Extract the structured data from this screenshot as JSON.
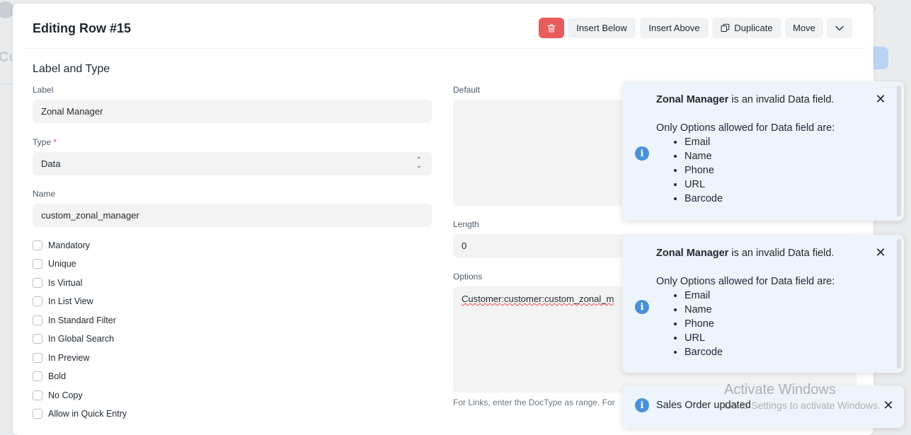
{
  "background": {
    "page_title": "Cu"
  },
  "dialog": {
    "title": "Editing Row #15",
    "toolbar": {
      "delete_icon": "trash-icon",
      "insert_below": "Insert Below",
      "insert_above": "Insert Above",
      "duplicate": "Duplicate",
      "move": "Move",
      "more_icon": "chevron-down-icon"
    },
    "section_title": "Label and Type",
    "fields": {
      "label": {
        "label": "Label",
        "value": "Zonal Manager"
      },
      "type": {
        "label": "Type",
        "required_mark": "*",
        "value": "Data"
      },
      "name": {
        "label": "Name",
        "value": "custom_zonal_manager"
      },
      "default": {
        "label": "Default",
        "value": ""
      },
      "length": {
        "label": "Length",
        "value": "0"
      },
      "options": {
        "label": "Options",
        "value": "Customer:customer:custom_zonal_m",
        "help": "For Links, enter the DocType as range. For"
      }
    },
    "checkboxes": [
      {
        "label": "Mandatory",
        "checked": false
      },
      {
        "label": "Unique",
        "checked": false
      },
      {
        "label": "Is Virtual",
        "checked": false
      },
      {
        "label": "In List View",
        "checked": false
      },
      {
        "label": "In Standard Filter",
        "checked": false
      },
      {
        "label": "In Global Search",
        "checked": false
      },
      {
        "label": "In Preview",
        "checked": false
      },
      {
        "label": "Bold",
        "checked": false
      },
      {
        "label": "No Copy",
        "checked": false
      },
      {
        "label": "Allow in Quick Entry",
        "checked": false
      }
    ]
  },
  "toasts": [
    {
      "bold": "Zonal Manager",
      "message": " is an invalid Data field.",
      "intro": "Only Options allowed for Data field are:",
      "options": [
        "Email",
        "Name",
        "Phone",
        "URL",
        "Barcode"
      ],
      "icon": "info-icon",
      "close_icon": "close-icon"
    },
    {
      "bold": "Zonal Manager",
      "message": " is an invalid Data field.",
      "intro": "Only Options allowed for Data field are:",
      "options": [
        "Email",
        "Name",
        "Phone",
        "URL",
        "Barcode"
      ],
      "icon": "info-icon",
      "close_icon": "close-icon"
    },
    {
      "message": "Sales Order updated",
      "icon": "info-icon",
      "close_icon": "close-icon"
    }
  ],
  "watermark": {
    "title": "Activate Windows",
    "subtitle": "Go to Settings to activate Windows."
  },
  "colors": {
    "danger": "#e95c5c",
    "info": "#4a90d9",
    "toast_bg": "#eef4fb"
  }
}
